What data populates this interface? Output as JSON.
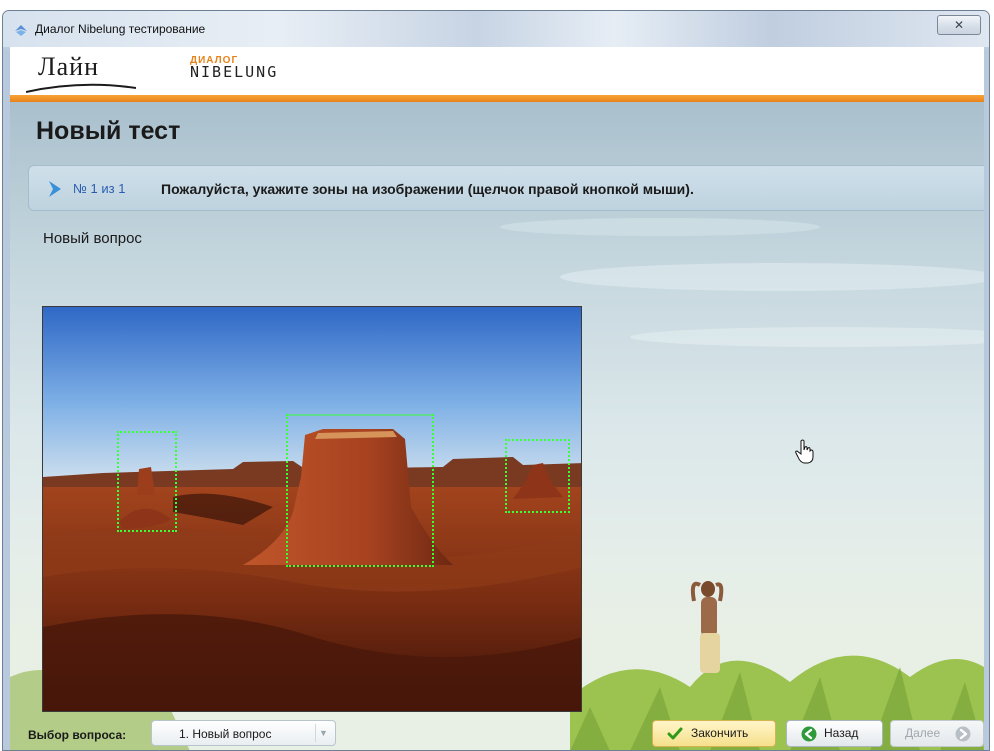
{
  "window": {
    "title": "Диалог Nibelung тестирование",
    "close_glyph": "✕"
  },
  "brand": {
    "logo_main": "Лайн",
    "logo_sub_top": "ДИАЛОГ",
    "logo_sub": "NIBELUNG"
  },
  "page": {
    "title": "Новый тест"
  },
  "question": {
    "number": "№ 1  из 1",
    "instruction": "Пожалуйста, укажите зоны на изображении (щелчок правой кнопкой мыши).",
    "body": "Новый вопрос"
  },
  "footer": {
    "select_label": "Выбор вопроса:",
    "select_value": "1. Новый вопрос",
    "finish_label": "Закончить",
    "back_label": "Назад",
    "next_label": "Далее"
  },
  "colors": {
    "accent_orange": "#e8821b",
    "zone_green": "#38ff36",
    "link_blue": "#2a5db0"
  },
  "icons": {
    "app": "app-icon",
    "chevron": "chevron-right-icon",
    "finish": "checkmark-icon",
    "back": "back-arrow-icon",
    "next": "next-arrow-icon",
    "cursor": "hand-cursor-icon"
  }
}
